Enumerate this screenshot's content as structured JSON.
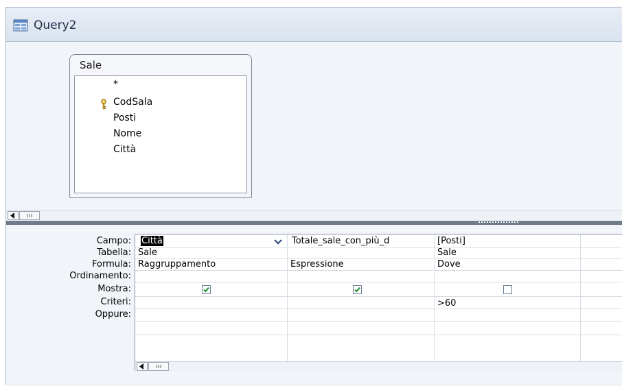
{
  "window": {
    "title": "Query2"
  },
  "table": {
    "name": "Sale",
    "fields": [
      "*",
      "CodSala",
      "Posti",
      "Nome",
      "Città"
    ],
    "primary_key_field": "CodSala"
  },
  "grid": {
    "row_labels": [
      "Campo:",
      "Tabella:",
      "Formula:",
      "Ordinamento:",
      "Mostra:",
      "Criteri:",
      "Oppure:"
    ],
    "columns": [
      {
        "campo": "Città",
        "tabella": "Sale",
        "formula": "Raggruppamento",
        "ordinamento": "",
        "mostra": true,
        "criteri": "",
        "oppure": ""
      },
      {
        "campo": "Totale_sale_con_più_d",
        "tabella": "",
        "formula": "Espressione",
        "ordinamento": "",
        "mostra": true,
        "criteri": "",
        "oppure": ""
      },
      {
        "campo": "[Posti]",
        "tabella": "Sale",
        "formula": "Dove",
        "ordinamento": "",
        "mostra": false,
        "criteri": ">60",
        "oppure": ""
      },
      {
        "campo": "",
        "tabella": "",
        "formula": "",
        "ordinamento": "",
        "mostra": null,
        "criteri": "",
        "oppure": ""
      }
    ]
  },
  "icons": {
    "title": "query-design-icon",
    "key": "primary-key-icon",
    "dropdown": "chevron-down-icon",
    "scroll_left": "arrow-left-icon",
    "scroll_thumb": "scroll-thumb-icon"
  }
}
